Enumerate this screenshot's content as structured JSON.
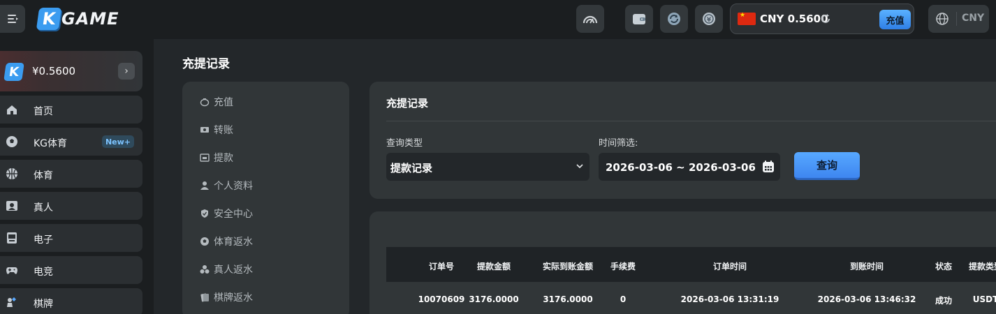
{
  "header": {
    "logo_text": "GAME",
    "logo_letter": "K",
    "wallet_currency": "CNY",
    "wallet_balance": "CNY 0.5600",
    "deposit_label": "充值",
    "language_code": "CNY",
    "icons": [
      "menu-icon",
      "speedometer-icon",
      "wallet-icon",
      "refresh-icon",
      "yuan-coin-icon",
      "globe-icon"
    ]
  },
  "sidebar": {
    "balance_card": {
      "letter": "K",
      "balance": "¥0.5600"
    },
    "items": [
      {
        "label": "首页",
        "icon": "home-icon"
      },
      {
        "label": "KG体育",
        "icon": "soccer-ball-icon",
        "badge": "New+"
      },
      {
        "label": "体育",
        "icon": "basketball-icon"
      },
      {
        "label": "真人",
        "icon": "live-dealer-icon"
      },
      {
        "label": "电子",
        "icon": "slot-machine-icon"
      },
      {
        "label": "电竞",
        "icon": "gamepad-icon"
      },
      {
        "label": "棋牌",
        "icon": "chess-icon"
      }
    ]
  },
  "main": {
    "page_title": "充提记录",
    "subnav": [
      {
        "label": "充值",
        "icon": "piggy-bank-icon"
      },
      {
        "label": "转账",
        "icon": "transfer-icon"
      },
      {
        "label": "提款",
        "icon": "withdraw-icon"
      },
      {
        "label": "个人资料",
        "icon": "user-icon"
      },
      {
        "label": "安全中心",
        "icon": "shield-icon"
      },
      {
        "label": "体育返水",
        "icon": "soccer-ball-icon"
      },
      {
        "label": "真人返水",
        "icon": "poker-chip-icon"
      },
      {
        "label": "棋牌返水",
        "icon": "cards-icon"
      }
    ],
    "filter": {
      "title": "充提记录",
      "type_label": "查询类型",
      "type_value": "提款记录",
      "time_label": "时间筛选:",
      "date_range": "2026-03-06 ~ 2026-03-06",
      "query_label": "查询"
    },
    "table": {
      "headers": [
        "订单号",
        "提款金额",
        "实际到账金额",
        "手续费",
        "订单时间",
        "到账时间",
        "状态",
        "提款类型"
      ],
      "rows": [
        [
          "10070609",
          "3176.0000",
          "3176.0000",
          "0",
          "2026-03-06 13:31:19",
          "2026-03-06 13:46:32",
          "成功",
          "USDT"
        ]
      ]
    }
  },
  "colors": {
    "accent": "#3e86f0",
    "background": "#23272a",
    "panel": "#313638",
    "header": "#1b1e20"
  }
}
